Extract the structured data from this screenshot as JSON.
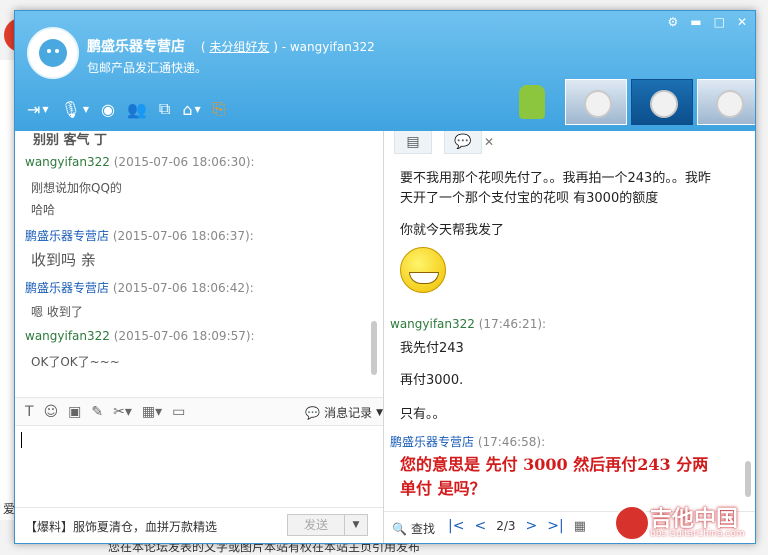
{
  "window": {
    "contact_name": "鹏盛乐器专营店",
    "group_label": "未分组好友",
    "account": "- wangyifan322",
    "signature": "包邮产品发汇通快递。"
  },
  "history": {
    "top_cut": "别别 客气 丁",
    "messages": [
      {
        "sender": "wangyifan322",
        "time": "(2015-07-06 18:06:30):",
        "lines": [
          "刚想说加你QQ的",
          "哈哈"
        ]
      },
      {
        "sender": "鹏盛乐器专营店",
        "time": "(2015-07-06 18:06:37):",
        "lines": [
          "收到吗 亲"
        ]
      },
      {
        "sender": "鹏盛乐器专营店",
        "time": "(2015-07-06 18:06:42):",
        "lines": [
          "嗯 收到了"
        ]
      },
      {
        "sender": "wangyifan322",
        "time": "(2015-07-06 18:09:57):",
        "lines": [
          "OK了OK了~~~"
        ]
      }
    ]
  },
  "input_toolbar": {
    "record_label": "消息记录"
  },
  "bottom": {
    "ad": "【爆料】服饰夏清仓，血拼万款精选",
    "send": "发送"
  },
  "chat": {
    "m1_lines": [
      "要不我用那个花呗先付了。。我再拍一个243的。。我昨",
      "天开了一个那个支付宝的花呗 有3000的额度"
    ],
    "m2": "你就今天帮我发了",
    "sender_me": "wangyifan322",
    "time_me": "(17:46:21):",
    "m3": "我先付243",
    "m4": "再付3000.",
    "m5": "只有。。",
    "sender_shop": "鹏盛乐器专营店",
    "time_shop": "(17:46:58):",
    "red_lines": [
      "您的意思是 先付 3000 然后再付243 分两",
      "单付 是吗？"
    ]
  },
  "pager": {
    "find": "查找",
    "page": "2/3"
  },
  "background": {
    "bottom_text": "您在本论坛发表的文字或图片本站有权在本站主页引用发布",
    "left_text": "爱"
  },
  "watermark": {
    "text": "吉他中国",
    "url": "bbs.GuitarChina.com"
  },
  "colors": {
    "titlebar": "#4fb0e6",
    "me_sender": "#2d7a3c",
    "shop_sender": "#1c5fb8",
    "emphasis": "#d31b1b"
  }
}
